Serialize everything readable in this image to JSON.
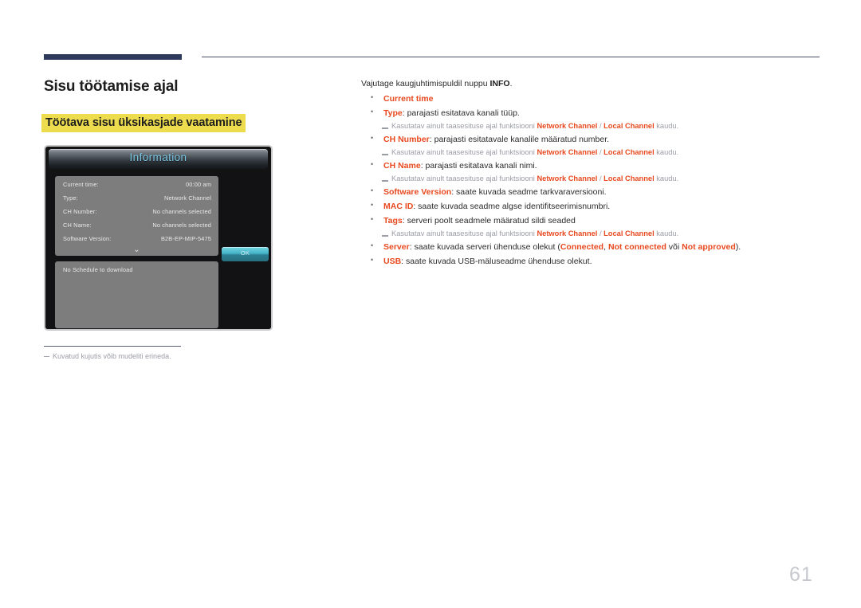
{
  "header": {
    "navy_rule_color": "#2e3a5c",
    "thin_rule_color": "#4a4f68"
  },
  "left": {
    "title": "Sisu töötamise ajal",
    "subtitle": "Töötava sisu üksikasjade vaatamine",
    "subtitle_highlight_color": "#eddc4e",
    "caption": "Kuvatud kujutis võib mudeliti erineda."
  },
  "tv": {
    "window_title": "Information",
    "rows": [
      {
        "label": "Current time:",
        "value": "00:00 am"
      },
      {
        "label": "Type:",
        "value": "Network Channel"
      },
      {
        "label": "CH Number:",
        "value": "No channels selected"
      },
      {
        "label": "CH Name:",
        "value": "No channels selected"
      },
      {
        "label": "Software Version:",
        "value": "B2B-EP-MIP-5475"
      }
    ],
    "expand_icon": "⌄",
    "schedule_text": "No Schedule to download",
    "ok_label": "OK"
  },
  "right": {
    "lead_pre": "Vajutage kaugjuhtimispuldil nuppu ",
    "lead_bold": "INFO",
    "lead_post": ".",
    "note_pre": "Kasutatav ainult taasesituse ajal funktsiooni ",
    "note_a": "Network Channel",
    "note_sep": " / ",
    "note_b": "Local Channel",
    "note_post": " kaudu.",
    "items": [
      {
        "key": "Current time",
        "text": ""
      },
      {
        "key": "Type",
        "text": ": parajasti esitatava kanali tüüp."
      },
      {
        "key": "CH Number",
        "text": ": parajasti esitatavale kanalile määratud number."
      },
      {
        "key": "CH Name",
        "text": ": parajasti esitatava kanali nimi."
      },
      {
        "key": "Software Version",
        "text": ": saate kuvada seadme tarkvaraversiooni."
      },
      {
        "key": "MAC ID",
        "text": ": saate kuvada seadme algse identifitseerimisnumbri."
      },
      {
        "key": "Tags",
        "text": ": serveri poolt seadmele määratud sildi seaded"
      },
      {
        "key": "Server",
        "text": ": saate kuvada serveri ühenduse olekut ("
      },
      {
        "key": "USB",
        "text": ": saate kuvada USB-mäluseadme ühenduse olekut."
      }
    ],
    "server_status_a": "Connected",
    "server_status_comma": ", ",
    "server_status_b": "Not connected",
    "server_status_or": " või ",
    "server_status_c": "Not approved",
    "server_status_close": ").",
    "accent_color": "#e8491f"
  },
  "page_number": "61"
}
